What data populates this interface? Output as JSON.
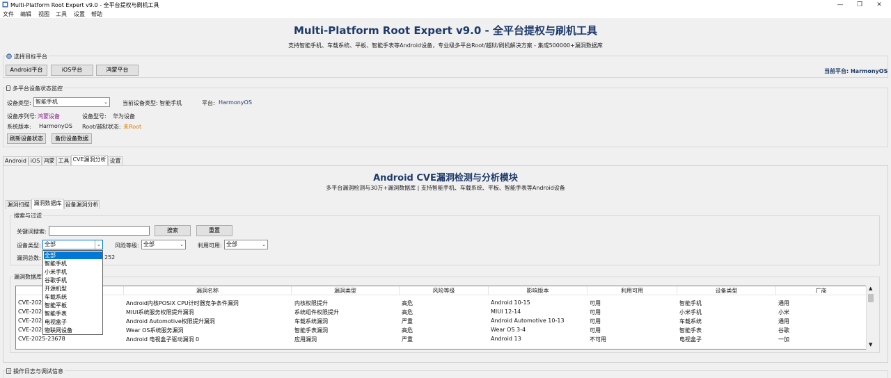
{
  "window": {
    "title": "Multi-Platform Root Expert v9.0 - 全平台提权与刷机工具"
  },
  "menu": [
    "文件",
    "编辑",
    "视图",
    "工具",
    "设置",
    "帮助"
  ],
  "header": {
    "title": "Multi-Platform Root Expert v9.0 - 全平台提权与刷机工具",
    "subtitle": "支持智能手机、车载系统、平板、智能手表等Android设备，专业级多平台Root/越狱/刷机解决方案 - 集成500000+漏洞数据库"
  },
  "platform_select": {
    "label": "选择目标平台",
    "buttons": [
      "Android平台",
      "iOS平台",
      "鸿蒙平台"
    ],
    "current": "当前平台: HarmonyOS"
  },
  "device_status": {
    "label": "多平台设备状态监控",
    "device_type_label": "设备类型:",
    "device_type_value": "智能手机",
    "current_type": "当前设备类型: 智能手机",
    "platform_label": "平台:",
    "platform_value": "HarmonyOS",
    "serial_label": "设备序列号:",
    "serial_value": "鸿蒙设备",
    "model_label": "设备型号:",
    "model_value": "华为设备",
    "sys_label": "系统版本:",
    "sys_value": "HarmonyOS",
    "root_label": "Root/越狱状态:",
    "root_value": "未Root",
    "refresh_btn": "刷新设备状态",
    "backup_btn": "备份设备数据"
  },
  "main_tabs": [
    "Android",
    "iOS",
    "鸿蒙",
    "工具",
    "CVE漏洞分析",
    "设置"
  ],
  "module": {
    "title": "Android CVE漏洞检测与分析模块",
    "subtitle": "多平台漏洞检测与30万+漏洞数据库 | 支持智能手机、车载系统、平板、智能手表等Android设备"
  },
  "sub_tabs": [
    "漏洞扫描",
    "漏洞数据库",
    "设备漏洞分析"
  ],
  "search": {
    "frame_label": "搜索与过滤",
    "keyword_label": "关键词搜索:",
    "search_btn": "搜索",
    "reset_btn": "重置",
    "device_type_label": "设备类型:",
    "device_type_value": "全部",
    "risk_label": "风险等级:",
    "risk_value": "全部",
    "exploit_label": "利用可用:",
    "exploit_value": "全部",
    "total_label": "漏洞总数:",
    "total_value": "252"
  },
  "dropdown_options": [
    "全部",
    "智能手机",
    "小米手机",
    "谷歌手机",
    "开源机型",
    "车载系统",
    "智能平板",
    "智能手表",
    "电视盒子",
    "物联网设备"
  ],
  "table": {
    "frame_label": "漏洞数据库",
    "columns": [
      "CVE编号",
      "漏洞名称",
      "漏洞类型",
      "风险等级",
      "影响版本",
      "利用可用",
      "设备类型",
      "厂商"
    ],
    "rows": [
      [
        "CVE-2025",
        "Android内核POSIX CPU计时器竞争条件漏洞",
        "内核权限提升",
        "高危",
        "Android 10-15",
        "可用",
        "智能手机",
        "通用"
      ],
      [
        "CVE-2024",
        "MIUI系统服务权限提升漏洞",
        "系统组件权限提升",
        "高危",
        "MIUI 12-14",
        "可用",
        "小米手机",
        "小米"
      ],
      [
        "CVE-2024",
        "Android Automotive权限提升漏洞",
        "车载系统漏洞",
        "严重",
        "Android Automotive 10-13",
        "可用",
        "车载系统",
        "通用"
      ],
      [
        "CVE-2024",
        "Wear OS系统服务漏洞",
        "智能手表漏洞",
        "高危",
        "Wear OS 3-4",
        "可用",
        "智能手表",
        "谷歌"
      ],
      [
        "CVE-2025-23678",
        "Android 电视盒子驱动漏洞 0",
        "应用漏洞",
        "严重",
        "Android 13",
        "不可用",
        "电视盒子",
        "一加"
      ]
    ]
  },
  "log_panel": {
    "label": "操作日志与调试信息"
  },
  "colors": {
    "title": "#1f3a6a",
    "serial": "#8b1a8b",
    "root_status": "#e07a00",
    "selection": "#0078d7"
  }
}
